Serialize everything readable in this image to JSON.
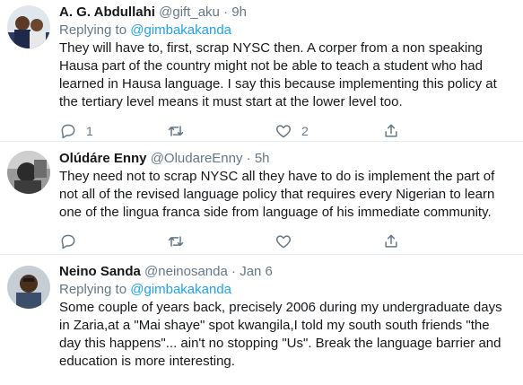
{
  "tweets": [
    {
      "name": "A. G. Abdullahi",
      "handle": "@gift_aku",
      "separator": "·",
      "time": "9h",
      "replying_prefix": "Replying to",
      "replying_to": "@gimbakakanda",
      "text": "They will have to, first, scrap NYSC then. A corper from a non speaking Hausa part of the country might not be able to teach a student who had learned in Hausa language. I say this because implementing this policy at the tertiary level means it must start at the lower level too.",
      "reply_count": "1",
      "retweet_count": "",
      "like_count": "2"
    },
    {
      "name": "Olúdáre Enny",
      "handle": "@OludareEnny",
      "separator": "·",
      "time": "5h",
      "text": "They need not to scrap NYSC all they have to do is implement the part of not all of the revised language policy that requires every Nigerian to learn one of the lingua franca side from language of his immediate community.",
      "reply_count": "",
      "retweet_count": "",
      "like_count": ""
    },
    {
      "name": "Neino Sanda",
      "handle": "@neinosanda",
      "separator": "·",
      "time": "Jan 6",
      "replying_prefix": "Replying to",
      "replying_to": "@gimbakakanda",
      "text": "Some couple of years back, precisely 2006 during my undergraduate days in Zaria,at a \"Mai shaye\" spot kwangila,I told my south south friends \"the day this happens\"... ain't no stopping \"Us\". Break the language barrier and education is more interesting."
    }
  ],
  "colors": {
    "link": "#1da1f2",
    "secondary_text": "#657786",
    "border": "#e6ecf0"
  },
  "icons": [
    "reply-icon",
    "retweet-icon",
    "like-icon",
    "share-icon"
  ]
}
